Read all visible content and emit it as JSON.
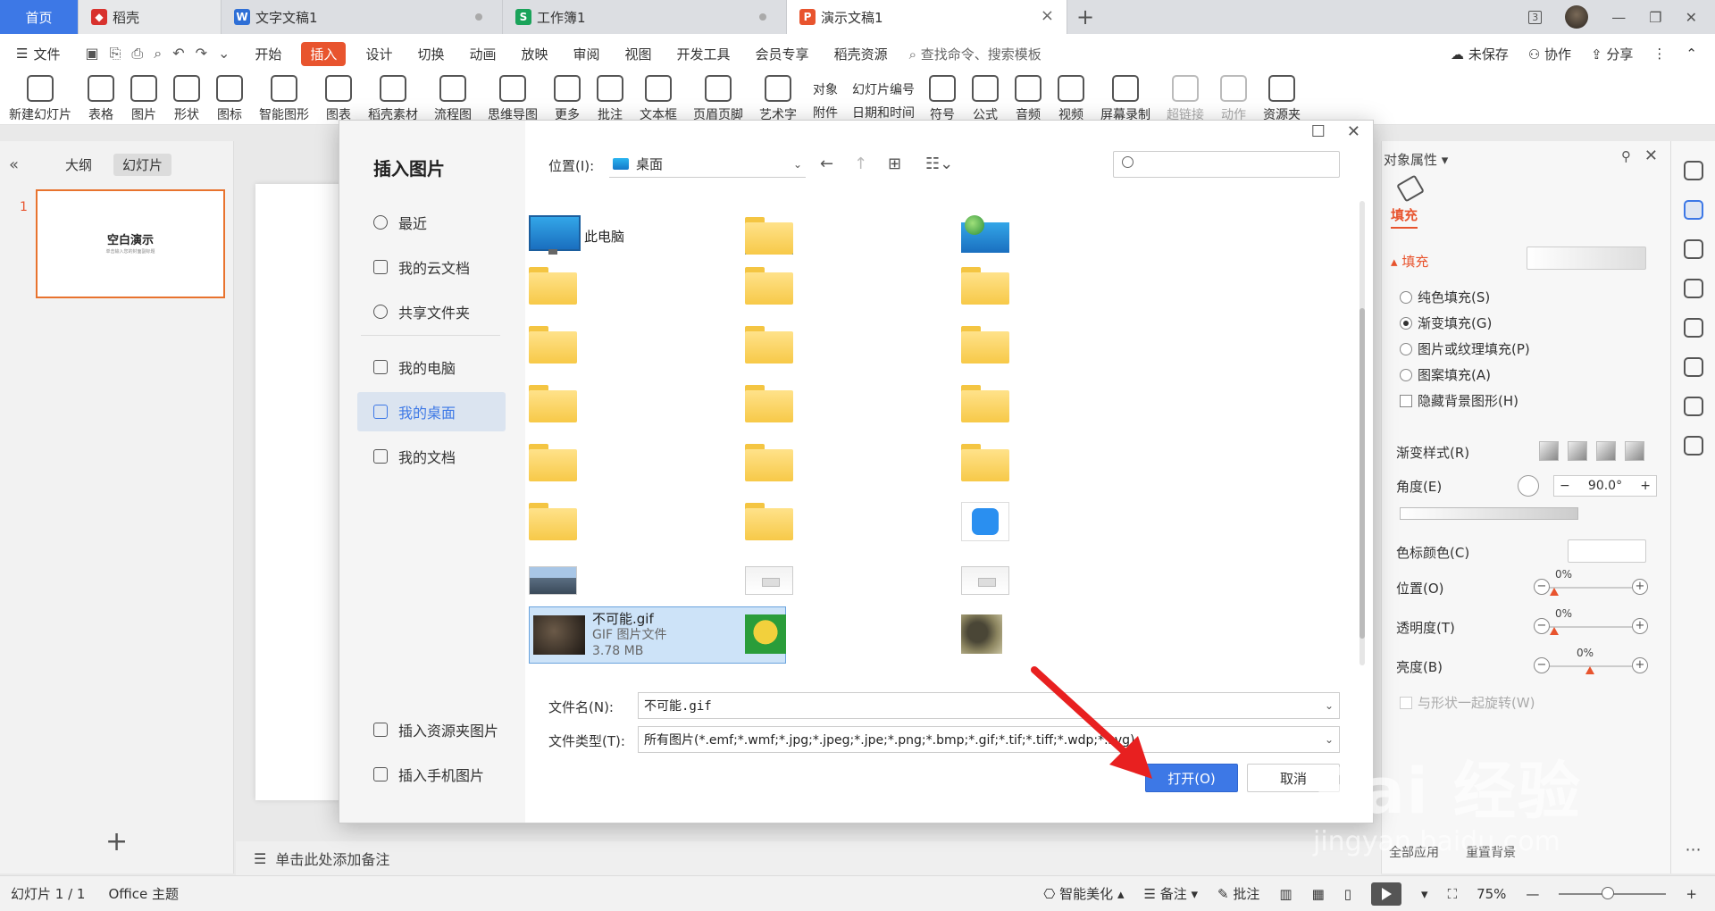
{
  "tabs": {
    "home": "首页",
    "t1": "稻壳",
    "t2": "文字文稿1",
    "t3": "工作簿1",
    "t4": "演示文稿1",
    "add": "+",
    "close": "×"
  },
  "window": {
    "badge": "3"
  },
  "menu": {
    "file": "文件",
    "items": [
      "开始",
      "插入",
      "设计",
      "切换",
      "动画",
      "放映",
      "审阅",
      "视图",
      "开发工具",
      "会员专享",
      "稻壳资源"
    ],
    "active": "插入",
    "search": "查找命令、搜索模板",
    "unsaved": "未保存",
    "collab": "协作",
    "share": "分享"
  },
  "ribbon": {
    "items": [
      "新建幻灯片",
      "表格",
      "图片",
      "形状",
      "图标",
      "智能图形",
      "图表",
      "稻壳素材",
      "流程图",
      "思维导图",
      "更多",
      "批注",
      "文本框",
      "页眉页脚",
      "艺术字"
    ],
    "small1": [
      "对象",
      "附件"
    ],
    "small2": [
      "幻灯片编号",
      "日期和时间"
    ],
    "items2": [
      "符号",
      "公式",
      "音频",
      "视频",
      "屏幕录制"
    ],
    "dim": [
      "超链接",
      "动作"
    ],
    "res": "资源夹"
  },
  "left": {
    "outline": "大纲",
    "slides": "幻灯片",
    "num": "1",
    "thumb_title": "空白演示",
    "thumb_sub": "单击输入您的封面副标题"
  },
  "notes": "单击此处添加备注",
  "right": {
    "title": "对象属性",
    "fill_tab": "填充",
    "fill_section": "填充",
    "options": [
      "纯色填充(S)",
      "渐变填充(G)",
      "图片或纹理填充(P)",
      "图案填充(A)"
    ],
    "selected_option": "渐变填充(G)",
    "hide_bg": "隐藏背景图形(H)",
    "grad_style": "渐变样式(R)",
    "angle_label": "角度(E)",
    "angle": "90.0°",
    "stop_color": "色标颜色(C)",
    "position": "位置(O)",
    "transparency": "透明度(T)",
    "brightness": "亮度(B)",
    "position_val": "0%",
    "transparency_val": "0%",
    "brightness_val": "0%",
    "rotate": "与形状一起旋转(W)",
    "apply_all": "全部应用",
    "reset": "重置背景"
  },
  "status": {
    "slide": "幻灯片 1 / 1",
    "theme": "Office 主题",
    "beautify": "智能美化",
    "notes": "备注",
    "comment": "批注",
    "zoom": "75%"
  },
  "dialog": {
    "title": "插入图片",
    "nav": [
      "最近",
      "我的云文档",
      "共享文件夹",
      "我的电脑",
      "我的桌面",
      "我的文档"
    ],
    "active_nav": "我的桌面",
    "bottom_nav": [
      "插入资源夹图片",
      "插入手机图片"
    ],
    "location_label": "位置(I):",
    "location": "桌面",
    "search_placeholder": "",
    "this_pc": "此电脑",
    "selected_file": {
      "name": "不可能.gif",
      "type": "GIF 图片文件",
      "size": "3.78 MB"
    },
    "filename_label": "文件名(N):",
    "filename": "不可能.gif",
    "filetype_label": "文件类型(T):",
    "filetype": "所有图片(*.emf;*.wmf;*.jpg;*.jpeg;*.jpe;*.png;*.bmp;*.gif;*.tif;*.tiff;*.wdp;*.svg)",
    "open": "打开(O)",
    "cancel": "取消"
  },
  "watermark": {
    "brand": "Bai 经验",
    "url": "jingyan.baidu.com"
  },
  "colors": {
    "accent": "#e8542e",
    "primary": "#3d78e6"
  }
}
